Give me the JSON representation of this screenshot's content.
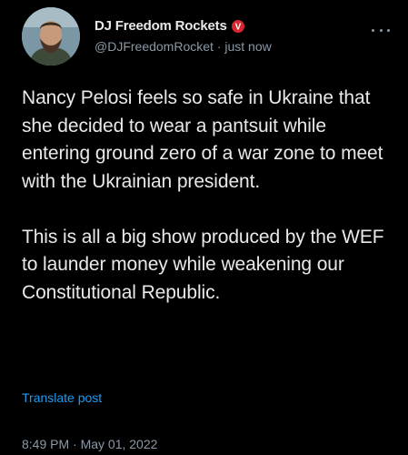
{
  "author": {
    "display_name": "DJ Freedom Rockets",
    "handle_time": "@DJFreedomRocket · just now",
    "badge_icon": "verified-red-badge-icon",
    "badge_color": "#d8262e",
    "badge_glyph": "V"
  },
  "post": {
    "paragraph_1": "Nancy Pelosi feels so safe in Ukraine that she decided to wear a pantsuit while entering ground zero of a war zone to meet with the Ukrainian president.",
    "paragraph_2": "This is all a big show produced by the WEF to launder money while weakening our Constitutional Republic.",
    "translate_label": "Translate post",
    "timestamp": "8:49 PM · May 01, 2022"
  },
  "colors": {
    "background": "#000000",
    "text": "#e7e9ea",
    "secondary": "#8b98a5",
    "link": "#1d9bf0"
  }
}
